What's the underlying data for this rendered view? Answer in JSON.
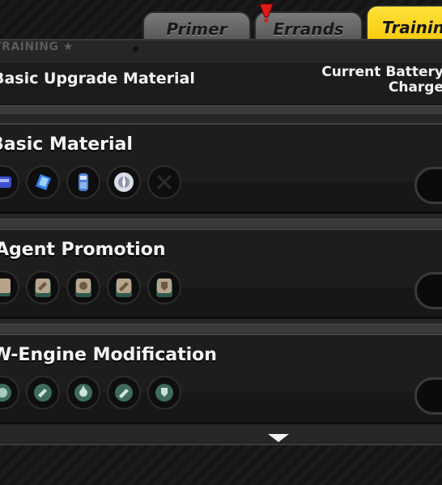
{
  "tabs": [
    {
      "label": "Primer",
      "active": false,
      "alert": false
    },
    {
      "label": "Errands",
      "active": false,
      "alert": true
    },
    {
      "label": "Training",
      "active": true,
      "alert": false
    }
  ],
  "breadcrumb": "TRAINING ★",
  "header": {
    "title": "Basic Upgrade Material",
    "battery_line1": "Current Battery",
    "battery_line2": "Charge"
  },
  "colors": {
    "accent": "#f5c400",
    "alert": "#e01a1a"
  },
  "cards": [
    {
      "title": "Basic Material",
      "icons": [
        "hdd-icon",
        "data-chip-icon",
        "battery-cell-icon",
        "disc-icon",
        "crossed-slot-icon",
        "extra-slot-icon"
      ]
    },
    {
      "title": "Agent Promotion",
      "icons": [
        "tool-chip-icon",
        "hammer-chip-icon",
        "radiation-chip-icon",
        "bullet-chip-icon",
        "shield-chip-icon",
        "extra-chip-icon"
      ]
    },
    {
      "title": "W-Engine Modification",
      "icons": [
        "wrench-gear-icon",
        "hammer-gear-icon",
        "radiation-gear-icon",
        "bullet-gear-icon",
        "shield-gear-icon",
        "extra-gear-icon"
      ]
    }
  ]
}
